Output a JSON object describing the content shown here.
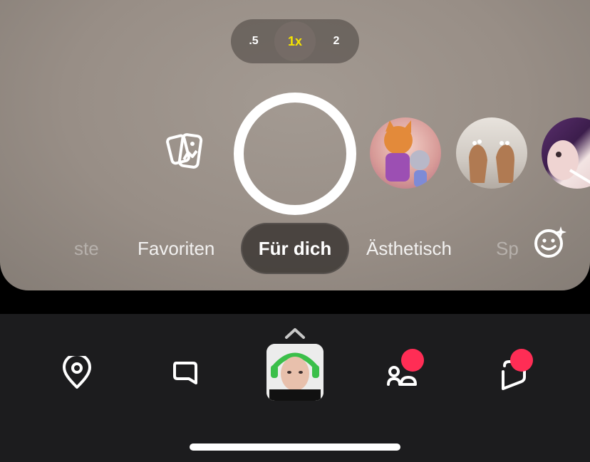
{
  "camera": {
    "zoom_options": [
      ".5",
      "1x",
      "2"
    ],
    "selected_zoom": "1x"
  },
  "lens_carousel": {
    "items": [
      {
        "name": "lens-cartoon-characters"
      },
      {
        "name": "lens-feet"
      },
      {
        "name": "lens-face-partial"
      }
    ]
  },
  "category_tabs": {
    "items": [
      "ste",
      "Favoriten",
      "Für dich",
      "Ästhetisch",
      "Sp"
    ],
    "selected": "Für dich"
  },
  "bottom_nav": {
    "items": [
      "map",
      "chat",
      "camera",
      "friends",
      "stories"
    ]
  },
  "colors": {
    "accent_yellow": "#f5e400",
    "notification_red": "#ff2d55",
    "nav_background": "#1c1c1e"
  }
}
